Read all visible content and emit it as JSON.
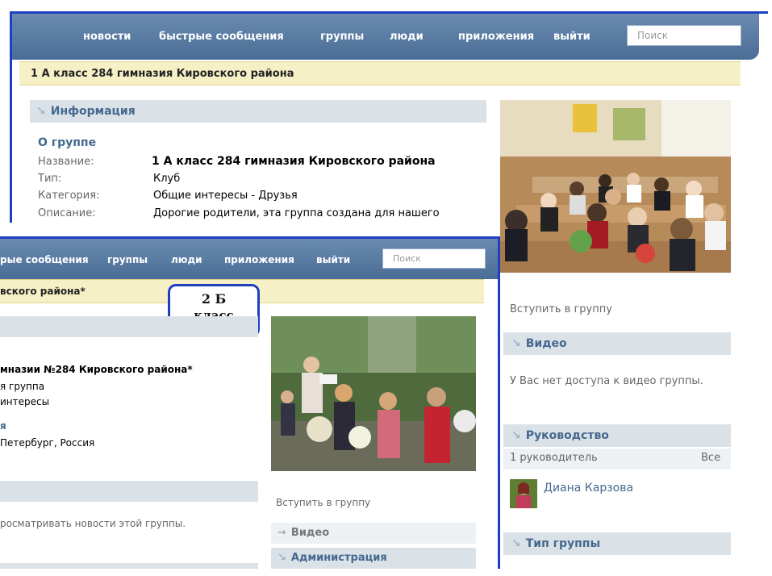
{
  "back": {
    "nav": [
      "новости",
      "быстрые сообщения",
      "группы",
      "люди",
      "приложения",
      "выйти"
    ],
    "search_placeholder": "Поиск",
    "title": "1 А класс 284 гимназия Кировского района",
    "info_heading": "Информация",
    "about_heading": "О группе",
    "fields": [
      {
        "label": "Название:",
        "value": "1 А класс 284 гимназия Кировского района"
      },
      {
        "label": "Тип:",
        "value": "Клуб"
      },
      {
        "label": "Категория:",
        "value": "Общие интересы - Друзья"
      },
      {
        "label": "Описание:",
        "value": "Дорогие родители, эта группа создана для нашего"
      }
    ],
    "join": "Вступить в группу",
    "video_heading": "Видео",
    "video_text": "У Вас нет доступа к видео группы.",
    "lead_heading": "Руководство",
    "lead_count": "1 руководитель",
    "lead_all": "Все",
    "lead_name": "Диана Карзова",
    "type_heading": "Тип группы"
  },
  "front": {
    "nav": [
      "рые сообщения",
      "группы",
      "люди",
      "приложения",
      "выйти"
    ],
    "search_placeholder": "Поиск",
    "title": "вского района*",
    "badge_line1": "2 Б",
    "badge_line2": "класс",
    "name_value": "мназии №284 Кировского района*",
    "type_value": "я группа",
    "category_value": "интересы",
    "city_heading": "я",
    "city_value": "Петербург, Россия",
    "news_text": "росматривать новости этой группы.",
    "join": "Вступить в группу",
    "video_item": "Видео",
    "admin_heading": "Администрация"
  },
  "colors": {
    "nav_blue": "#4a6d96",
    "frame_blue": "#1f3fc0",
    "title_yellow": "#f6f0c6",
    "section_grey": "#dae2e8",
    "link_blue": "#45688e"
  }
}
